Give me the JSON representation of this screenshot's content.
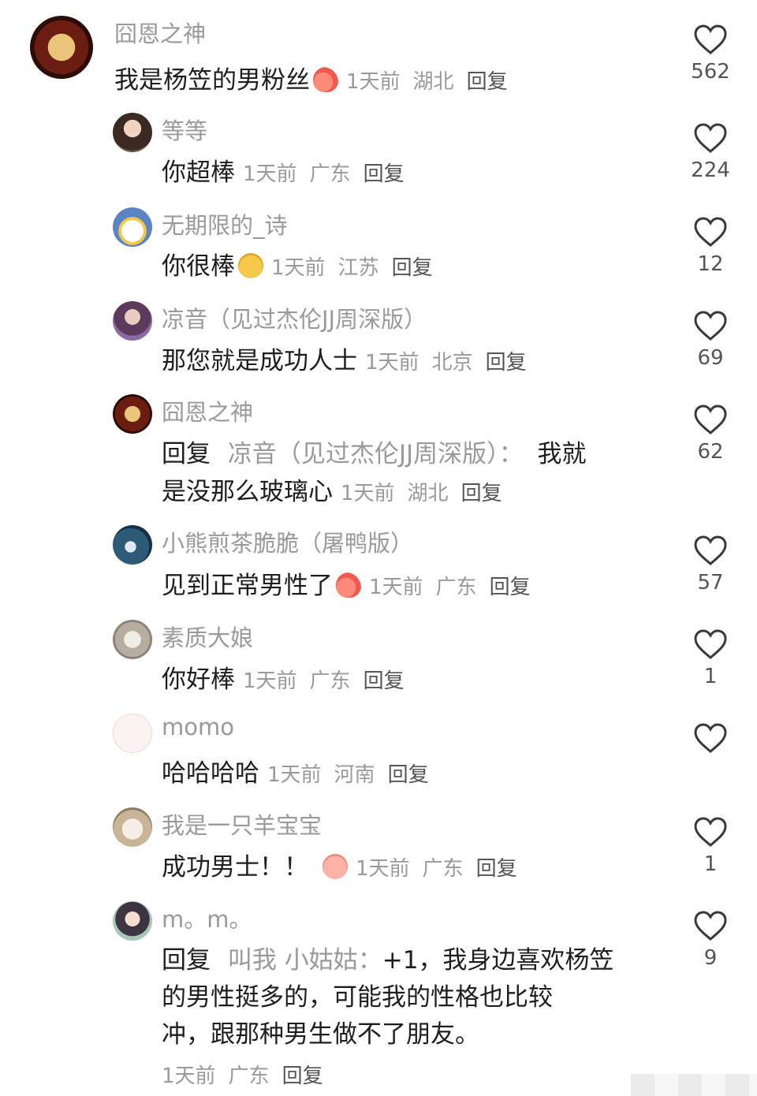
{
  "comments": [
    {
      "username": "囧恩之神",
      "text": "我是杨笠的男粉丝",
      "emoji": "peach-emoji",
      "time": "1天前",
      "location": "湖北",
      "reply_label": "回复",
      "likes": "562"
    },
    {
      "username": "等等",
      "text": "你超棒",
      "time": "1天前",
      "location": "广东",
      "reply_label": "回复",
      "likes": "224"
    },
    {
      "username": "无期限的_诗",
      "text": "你很棒",
      "emoji": "dog-emoji",
      "time": "1天前",
      "location": "江苏",
      "reply_label": "回复",
      "likes": "12"
    },
    {
      "username": "凉音（见过杰伦JJ周深版）",
      "text": "那您就是成功人士",
      "time": "1天前",
      "location": "北京",
      "reply_label": "回复",
      "likes": "69"
    },
    {
      "username": "囧恩之神",
      "reply_prefix": "回复",
      "mention": "凉音（见过杰伦JJ周深版）：",
      "text_line1": "我就",
      "text_line2": "是没那么玻璃心",
      "time": "1天前",
      "location": "湖北",
      "reply_label": "回复",
      "likes": "62"
    },
    {
      "username": "小熊煎茶脆脆（屠鸭版）",
      "text": "见到正常男性了",
      "emoji": "peach-emoji",
      "time": "1天前",
      "location": "广东",
      "reply_label": "回复",
      "likes": "57"
    },
    {
      "username": "素质大娘",
      "text": "你好棒",
      "time": "1天前",
      "location": "广东",
      "reply_label": "回复",
      "likes": "1"
    },
    {
      "username": "momo",
      "text": "哈哈哈哈",
      "time": "1天前",
      "location": "河南",
      "reply_label": "回复",
      "likes": ""
    },
    {
      "username": "我是一只羊宝宝",
      "text": "成功男士！！",
      "emoji": "pig-emoji",
      "time": "1天前",
      "location": "广东",
      "reply_label": "回复",
      "likes": "1"
    },
    {
      "username": "m。m。",
      "reply_prefix": "回复",
      "mention": "叫我 小姑姑：",
      "text_line1": "+1，我身边喜欢杨笠",
      "text_line2": "的男性挺多的，可能我的性格也比较",
      "text_line3": "冲，跟那种男生做不了朋友。",
      "time": "1天前",
      "location": "广东",
      "reply_label": "回复",
      "likes": "9"
    }
  ],
  "colors": {
    "muted": "#9a9a9a",
    "body": "#1e1e1e",
    "reply": "#555555"
  }
}
